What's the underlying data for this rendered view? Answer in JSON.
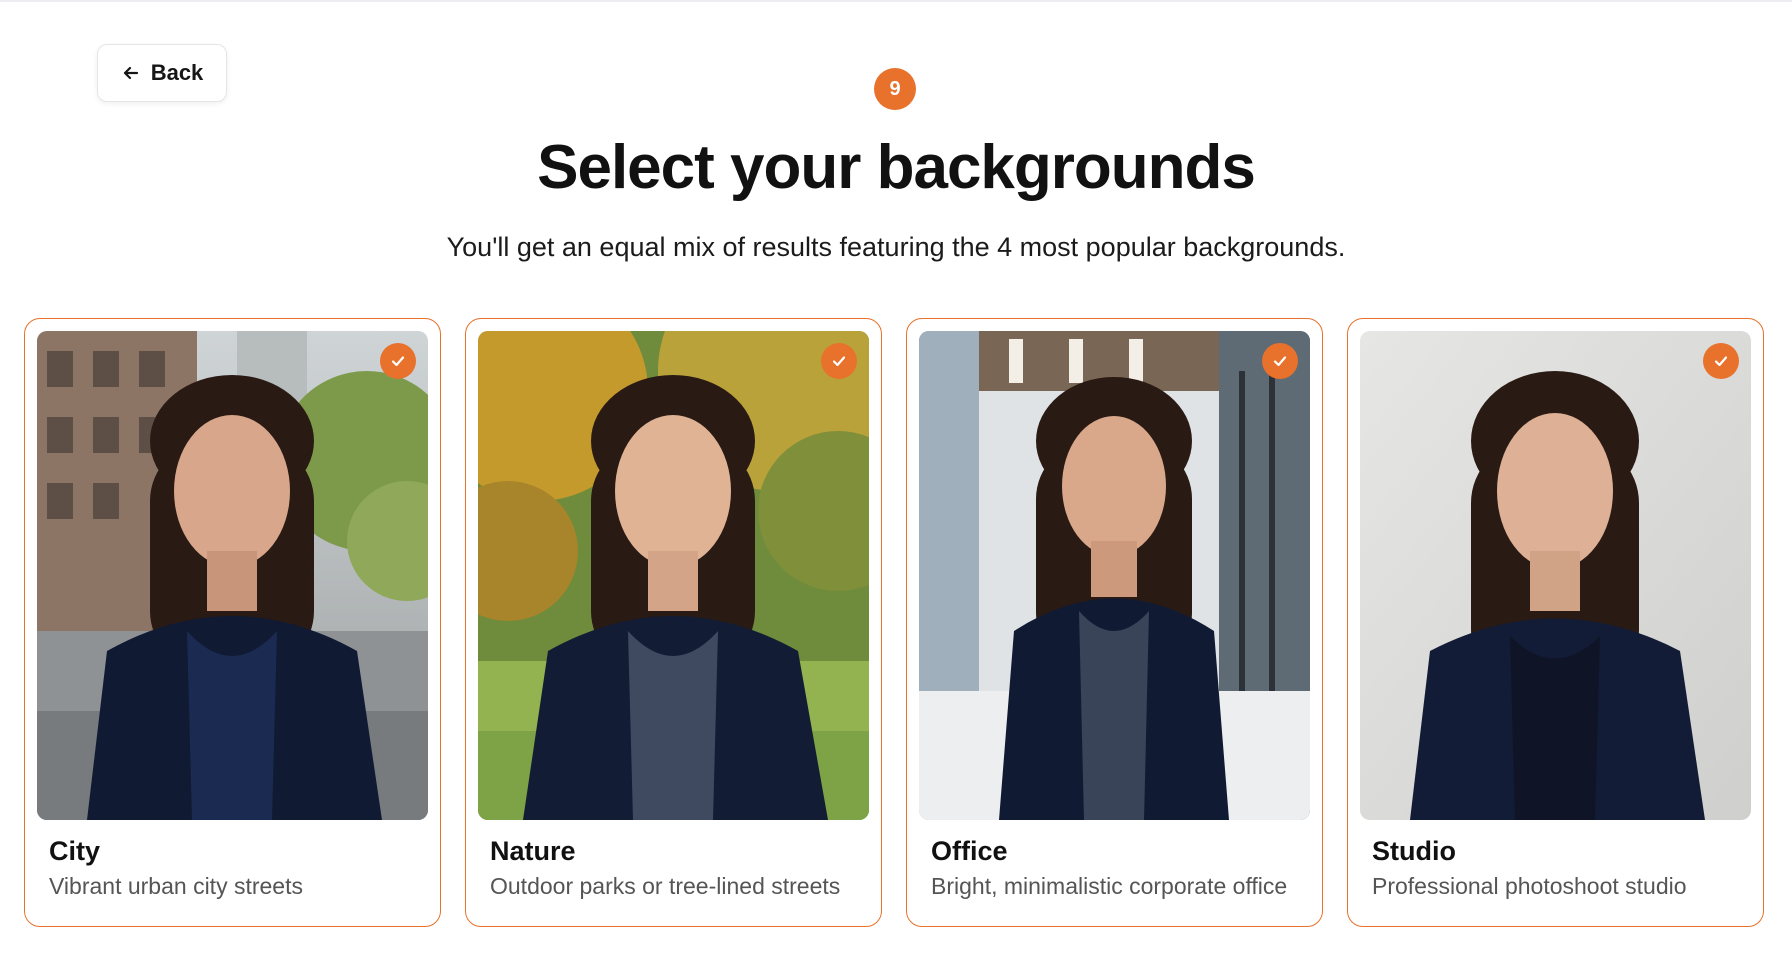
{
  "nav": {
    "back_label": "Back",
    "back_icon": "arrow-left-icon"
  },
  "step": {
    "number": "9"
  },
  "header": {
    "title": "Select your backgrounds",
    "subtitle": "You'll get an equal mix of results featuring the 4 most popular backgrounds."
  },
  "colors": {
    "accent": "#e8712c",
    "text": "#111111",
    "muted": "#555555"
  },
  "backgrounds": [
    {
      "title": "City",
      "description": "Vibrant urban city streets",
      "selected": true,
      "photo": "city-portrait-photo"
    },
    {
      "title": "Nature",
      "description": "Outdoor parks or tree-lined streets",
      "selected": true,
      "photo": "nature-portrait-photo"
    },
    {
      "title": "Office",
      "description": "Bright, minimalistic corporate office",
      "selected": true,
      "photo": "office-portrait-photo"
    },
    {
      "title": "Studio",
      "description": "Professional photoshoot studio",
      "selected": true,
      "photo": "studio-portrait-photo"
    }
  ]
}
